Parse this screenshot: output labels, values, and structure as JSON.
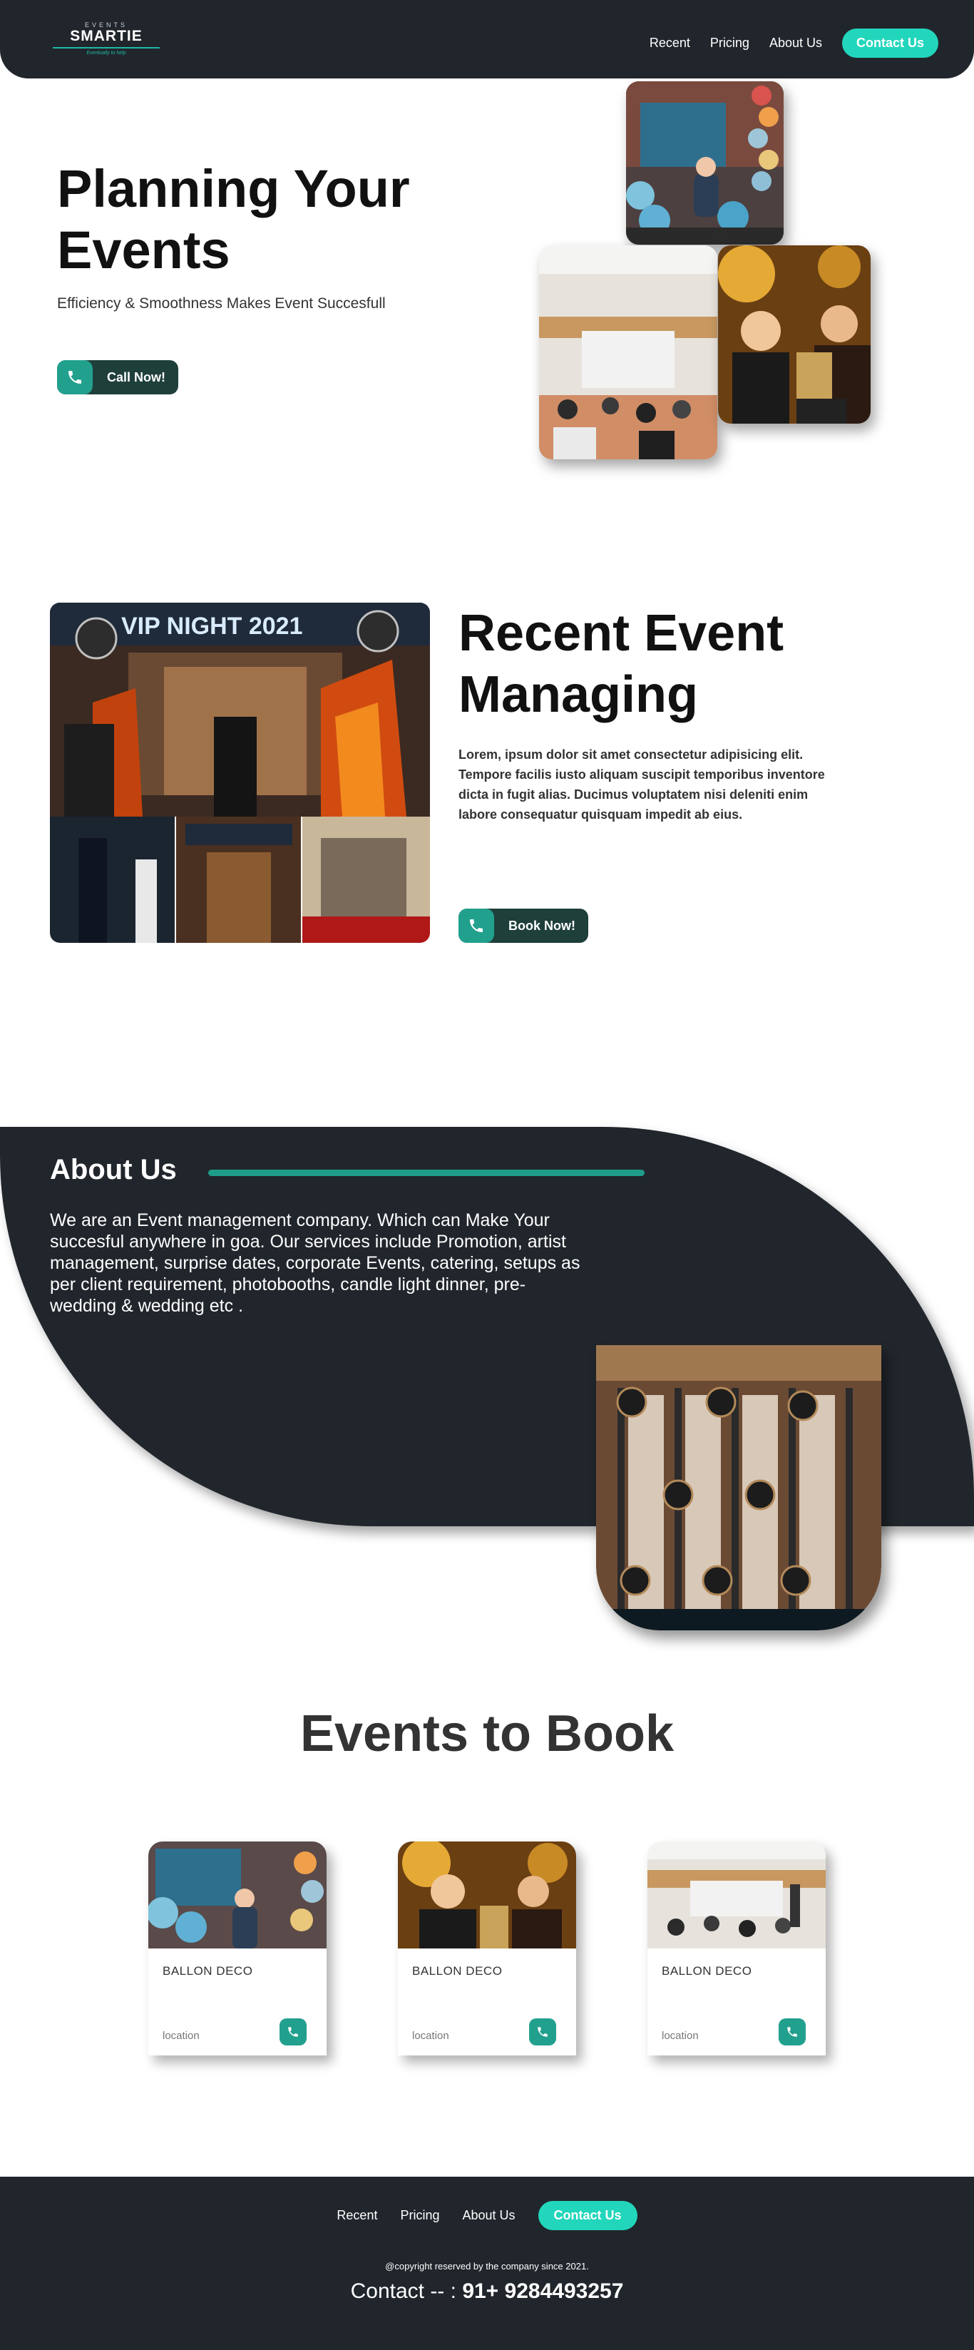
{
  "nav": {
    "logo_top": "EVENTS",
    "logo_main": "SMARTIE",
    "logo_tag": "Eventually to help",
    "links": [
      "Recent",
      "Pricing",
      "About Us"
    ],
    "contact": "Contact Us"
  },
  "hero": {
    "title_line1": "Planning Your",
    "title_line2": "Events",
    "subtitle": "Efficiency & Smoothness Makes Event Succesfull",
    "cta": "Call Now!"
  },
  "recent": {
    "title_line1": "Recent Event",
    "title_line2": "Managing",
    "text": "Lorem, ipsum dolor sit amet consectetur adipisicing elit. Tempore facilis iusto aliquam suscipit temporibus inventore dicta in fugit alias. Ducimus voluptatem nisi deleniti enim labore consequatur quisquam impedit ab eius.",
    "cta": "Book Now!",
    "banner": "VIP NIGHT 2021"
  },
  "about": {
    "title": "About Us",
    "text": "We are an Event management company. Which can Make Your succesful anywhere in goa. Our services include Promotion, artist management, surprise dates, corporate Events, catering, setups as per client requirement, photobooths, candle light dinner, pre-wedding & wedding etc ."
  },
  "events": {
    "title": "Events to Book",
    "cards": [
      {
        "title": "BALLON DECO",
        "location": "location"
      },
      {
        "title": "BALLON DECO",
        "location": "location"
      },
      {
        "title": "BALLON DECO",
        "location": "location"
      }
    ]
  },
  "footer": {
    "links": [
      "Recent",
      "Pricing",
      "About Us"
    ],
    "contact_btn": "Contact Us",
    "copyright": "@copyright reserved by the company since 2021.",
    "contact_label": "Contact -- : ",
    "phone": "91+ 9284493257"
  },
  "colors": {
    "dark": "#21262c",
    "accent": "#22d6bc",
    "teal": "#22a08e",
    "white": "#ffffff"
  },
  "icons": [
    "phone-icon"
  ]
}
